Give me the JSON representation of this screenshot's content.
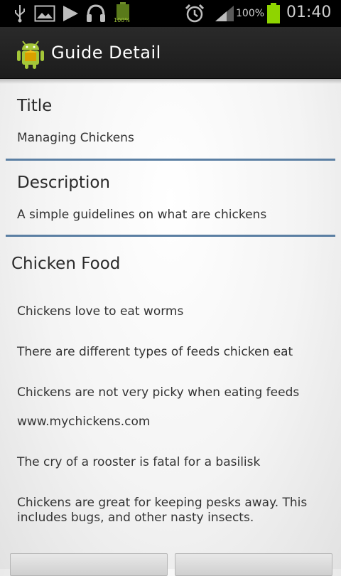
{
  "status_bar": {
    "battery_percent_label": "100%",
    "battery_small_label": "100%",
    "time": "01:40"
  },
  "action_bar": {
    "title": "Guide Detail"
  },
  "title_section": {
    "heading": "Title",
    "value": "Managing Chickens"
  },
  "description_section": {
    "heading": "Description",
    "value": "A simple guidelines on what are chickens"
  },
  "food_section": {
    "heading": "Chicken Food",
    "items": [
      "Chickens love to eat worms",
      "There are different types of feeds chicken eat",
      "Chickens are not very picky when eating feeds",
      "www.mychickens.com",
      "The cry of a rooster is fatal for a basilisk",
      "Chickens are great for keeping pesks away. This includes bugs, and other nasty insects."
    ]
  },
  "colors": {
    "divider": "#5b7fa3",
    "action_bar": "#222222",
    "battery": "#8fd400"
  }
}
